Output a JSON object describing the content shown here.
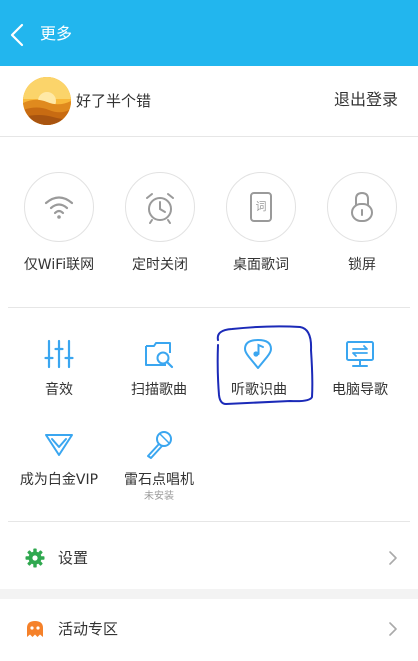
{
  "header": {
    "title": "更多"
  },
  "user": {
    "name": "好了半个错",
    "logout_label": "退出登录"
  },
  "quick_actions": [
    {
      "label": "仅WiFi联网",
      "icon": "wifi-icon"
    },
    {
      "label": "定时关闭",
      "icon": "alarm-clock-icon"
    },
    {
      "label": "桌面歌词",
      "icon": "desktop-lyrics-icon",
      "icon_text": "词"
    },
    {
      "label": "锁屏",
      "icon": "lock-icon"
    }
  ],
  "features": [
    {
      "label": "音效",
      "icon": "equalizer-icon"
    },
    {
      "label": "扫描歌曲",
      "icon": "scan-folder-icon"
    },
    {
      "label": "听歌识曲",
      "icon": "music-recognition-icon"
    },
    {
      "label": "电脑导歌",
      "icon": "pc-transfer-icon"
    },
    {
      "label": "成为白金VIP",
      "icon": "vip-diamond-icon"
    },
    {
      "label": "雷石点唱机",
      "icon": "microphone-icon",
      "sub": "未安装"
    }
  ],
  "menu": [
    {
      "label": "设置",
      "icon": "gear-icon",
      "icon_color": "#2fa84f"
    },
    {
      "label": "活动专区",
      "icon": "ghost-icon",
      "icon_color": "#f5812a"
    }
  ],
  "colors": {
    "header": "#22b6ee",
    "feature_icon": "#3aa6f0",
    "annotation": "#1b2ab8"
  }
}
